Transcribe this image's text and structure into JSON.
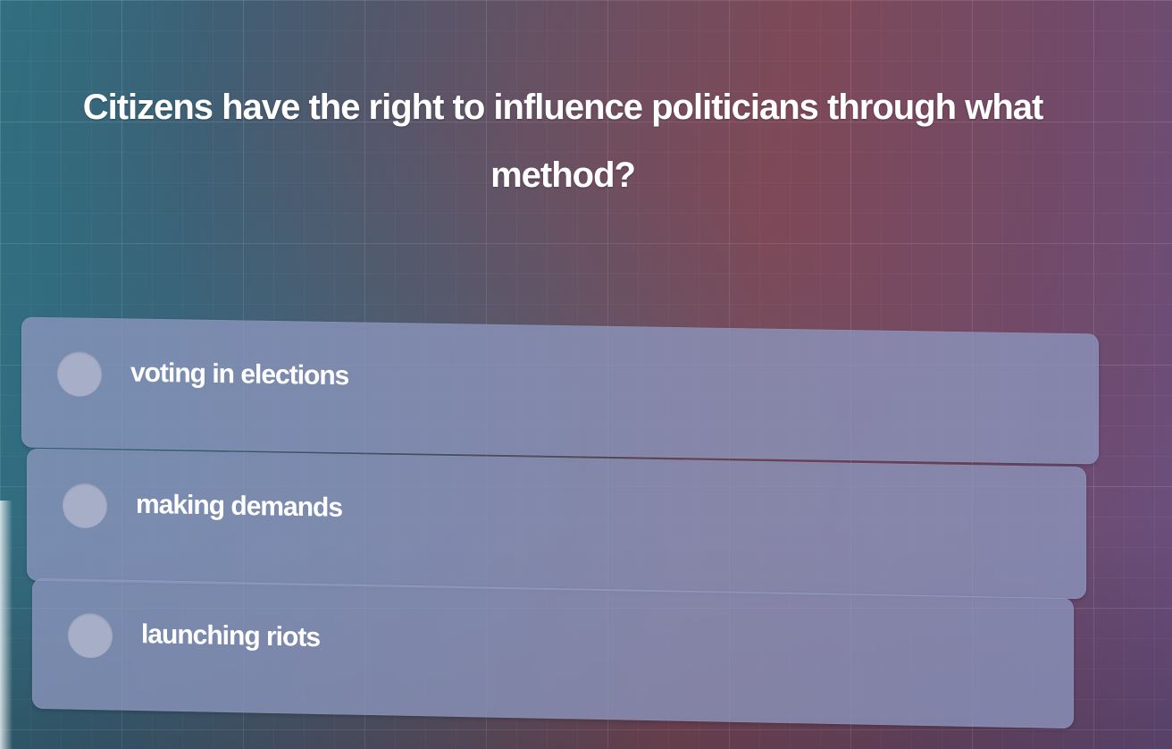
{
  "quiz": {
    "question": "Citizens have the right to influence politicians through what method?",
    "options": [
      {
        "label": "voting in elections",
        "selected": false
      },
      {
        "label": "making demands",
        "selected": false
      },
      {
        "label": "launching riots",
        "selected": false
      }
    ]
  }
}
